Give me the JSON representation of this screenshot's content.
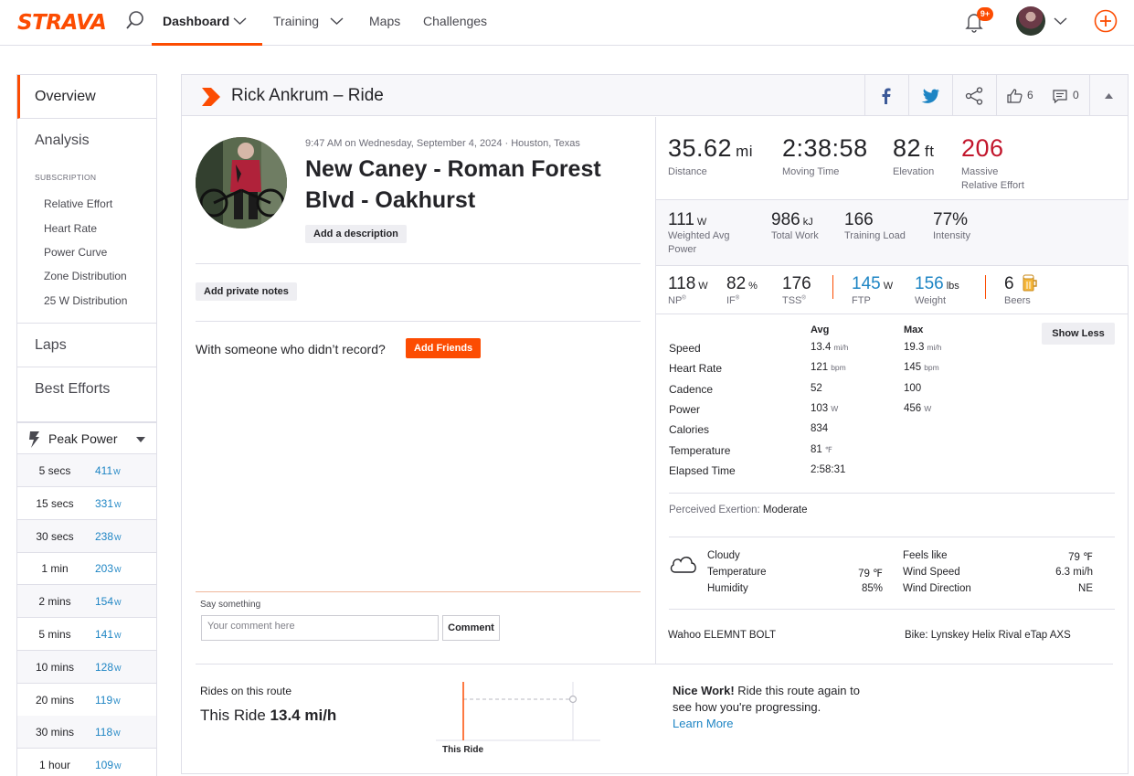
{
  "nav": {
    "logo": "STRAVA",
    "items": [
      "Dashboard",
      "Training",
      "Maps",
      "Challenges"
    ],
    "notif_badge": "9+"
  },
  "sidebar": {
    "overview": "Overview",
    "analysis": "Analysis",
    "subscription_label": "SUBSCRIPTION",
    "sub_items": [
      "Relative Effort",
      "Heart Rate",
      "Power Curve",
      "Zone Distribution",
      "25 W Distribution"
    ],
    "laps": "Laps",
    "best_efforts": "Best Efforts",
    "peak_power": "Peak Power",
    "power_unit": "W",
    "peaks": [
      {
        "label": "5 secs",
        "value": "411"
      },
      {
        "label": "15 secs",
        "value": "331"
      },
      {
        "label": "30 secs",
        "value": "238"
      },
      {
        "label": "1 min",
        "value": "203"
      },
      {
        "label": "2 mins",
        "value": "154"
      },
      {
        "label": "5 mins",
        "value": "141"
      },
      {
        "label": "10 mins",
        "value": "128"
      },
      {
        "label": "20 mins",
        "value": "119"
      },
      {
        "label": "30 mins",
        "value": "118"
      },
      {
        "label": "1 hour",
        "value": "109"
      }
    ]
  },
  "header": {
    "title": "Rick Ankrum – Ride",
    "kudos": "6",
    "comments": "0"
  },
  "activity": {
    "meta": "9:47 AM on Wednesday, September 4, 2024 · Houston, Texas",
    "title": "New Caney - Roman Forest Blvd - Oakhurst",
    "add_description": "Add a description",
    "add_private_notes": "Add private notes",
    "friends_prompt": "With someone who didn’t record?",
    "add_friends": "Add Friends",
    "say_something": "Say something",
    "comment_placeholder": "Your comment here",
    "comment_button": "Comment"
  },
  "stats": {
    "distance": {
      "value": "35.62",
      "unit": "mi",
      "label": "Distance"
    },
    "moving_time": {
      "value": "2:38:58",
      "label": "Moving Time"
    },
    "elevation": {
      "value": "82",
      "unit": "ft",
      "label": "Elevation"
    },
    "relative_effort": {
      "value": "206",
      "label1": "Massive",
      "label2": "Relative Effort"
    },
    "weighted_power": {
      "value": "111",
      "unit": "W",
      "label1": "Weighted Avg",
      "label2": "Power"
    },
    "total_work": {
      "value": "986",
      "unit": "kJ",
      "label": "Total Work"
    },
    "training_load": {
      "value": "166",
      "label": "Training Load"
    },
    "intensity": {
      "value": "77%",
      "label": "Intensity"
    },
    "np": {
      "value": "118",
      "unit": "W",
      "label": "NP",
      "sup": "®"
    },
    "if": {
      "value": "82",
      "unit": "%",
      "label": "IF",
      "sup": "®"
    },
    "tss": {
      "value": "176",
      "label": "TSS",
      "sup": "®"
    },
    "ftp": {
      "value": "145",
      "unit": "W",
      "label": "FTP"
    },
    "weight": {
      "value": "156",
      "unit": "lbs",
      "label": "Weight"
    },
    "beers": {
      "value": "6",
      "label": "Beers"
    }
  },
  "details": {
    "avg_header": "Avg",
    "max_header": "Max",
    "show_less": "Show Less",
    "rows": [
      {
        "label": "Speed",
        "avg": "13.4",
        "avg_unit": "mi/h",
        "max": "19.3",
        "max_unit": "mi/h"
      },
      {
        "label": "Heart Rate",
        "avg": "121",
        "avg_unit": "bpm",
        "max": "145",
        "max_unit": "bpm"
      },
      {
        "label": "Cadence",
        "avg": "52",
        "avg_unit": "",
        "max": "100",
        "max_unit": ""
      },
      {
        "label": "Power",
        "avg": "103",
        "avg_unit": "W",
        "max": "456",
        "max_unit": "W"
      },
      {
        "label": "Calories",
        "avg": "834",
        "avg_unit": "",
        "max": "",
        "max_unit": ""
      },
      {
        "label": "Temperature",
        "avg": "81",
        "avg_unit": "℉",
        "max": "",
        "max_unit": ""
      },
      {
        "label": "Elapsed Time",
        "avg": "2:58:31",
        "avg_unit": "",
        "max": "",
        "max_unit": ""
      }
    ],
    "exertion_label": "Perceived Exertion:",
    "exertion_value": "Moderate"
  },
  "weather": {
    "condition": "Cloudy",
    "temperature_label": "Temperature",
    "temperature": "79 ℉",
    "humidity_label": "Humidity",
    "humidity": "85%",
    "feels_like_label": "Feels like",
    "feels_like": "79 ℉",
    "wind_speed_label": "Wind Speed",
    "wind_speed": "6.3 mi/h",
    "wind_dir_label": "Wind Direction",
    "wind_dir": "NE"
  },
  "gear": {
    "device": "Wahoo ELEMNT BOLT",
    "bike": "Bike: Lynskey Helix Rival eTap AXS"
  },
  "route": {
    "label": "Rides on this route",
    "this_ride_prefix": "This Ride",
    "this_ride_speed": "13.4 mi/h",
    "chart_label": "This Ride",
    "nice_work": "Nice Work!",
    "message": "Ride this route again to see how you're progressing.",
    "learn_more": "Learn More"
  },
  "colors": {
    "accent": "#fc4c02",
    "link": "#1e85c4",
    "effort": "#c2162c"
  }
}
